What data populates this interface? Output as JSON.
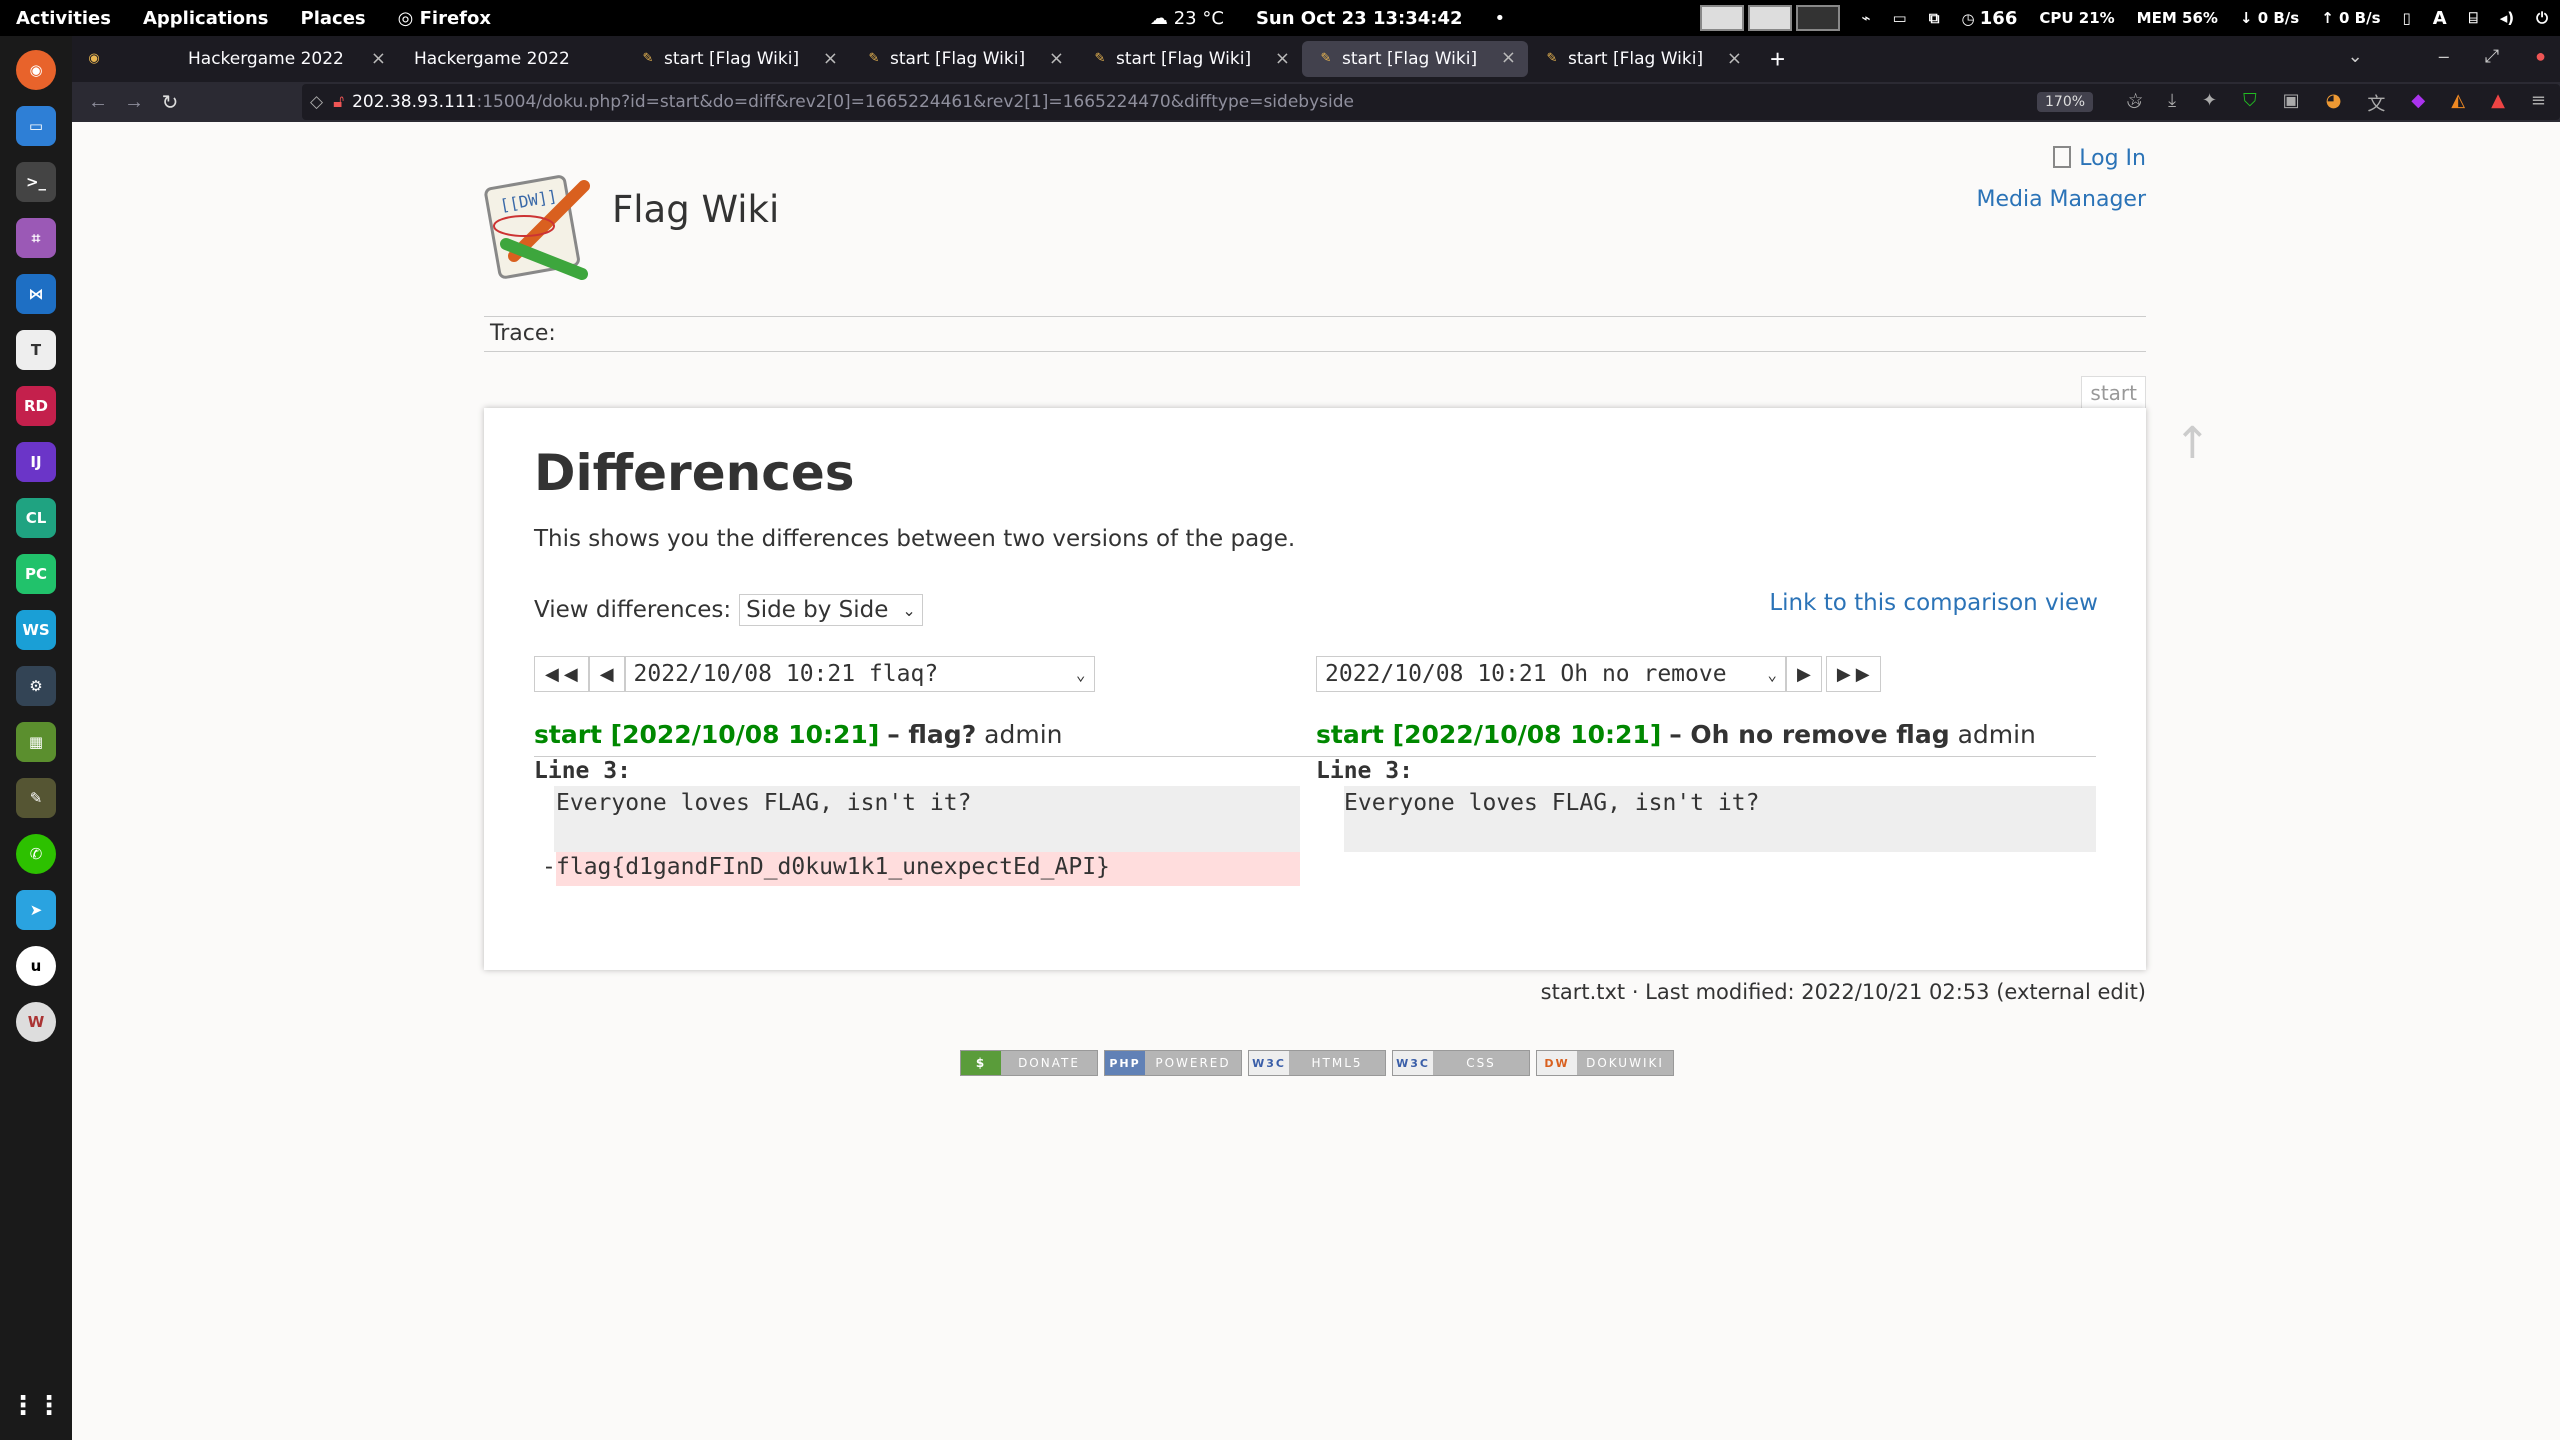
{
  "topbar": {
    "activities": "Activities",
    "applications": "Applications",
    "places": "Places",
    "firefox": "Firefox",
    "weather": "23 °C",
    "datetime": "Sun Oct 23  13:34:42",
    "dot": "•",
    "process_count": "166",
    "cpu_label": "CPU",
    "cpu_value": "21%",
    "mem_label": "MEM",
    "mem_value": "56%",
    "down_rate": "0 B/s",
    "up_rate": "0 B/s",
    "keyboard": "A"
  },
  "tabs": [
    {
      "label": "Hackergame 2022",
      "favicon": "dot-icon"
    },
    {
      "label": "Hackergame 2022",
      "favicon": "dot-icon"
    },
    {
      "label": "start [Flag Wiki]",
      "favicon": "dokuwiki-icon"
    },
    {
      "label": "start [Flag Wiki]",
      "favicon": "dokuwiki-icon"
    },
    {
      "label": "start [Flag Wiki]",
      "favicon": "dokuwiki-icon"
    },
    {
      "label": "start [Flag Wiki]",
      "favicon": "dokuwiki-icon",
      "active": true
    },
    {
      "label": "start [Flag Wiki]",
      "favicon": "dokuwiki-icon"
    }
  ],
  "navbar": {
    "url_host": "202.38.93.111",
    "url_rest": ":15004/doku.php?id=start&do=diff&rev2[0]=1665224461&rev2[1]=1665224470&difftype=sidebyside",
    "zoom": "170%"
  },
  "site": {
    "title": "Flag Wiki",
    "login": "Log In",
    "media_manager": "Media Manager",
    "trace": "Trace:",
    "page_tab": "start"
  },
  "diff": {
    "heading": "Differences",
    "intro": "This shows you the differences between two versions of the page.",
    "view_label": "View differences:",
    "view_value": "Side by Side",
    "compare_link": "Link to this comparison view",
    "left_select": "2022/10/08 10:21 flaq?",
    "right_select": "2022/10/08 10:21 Oh no remove",
    "left": {
      "link": "start [2022/10/08 10:21]",
      "summary": "– flag?",
      "user": "admin",
      "line_label": "Line 3:",
      "context": "Everyone loves FLAG, isn't it?",
      "deleted_sign": "-",
      "deleted": "flag{d1gandFInD_d0kuw1k1_unexpectEd_API}"
    },
    "right": {
      "link": "start [2022/10/08 10:21]",
      "summary": "– Oh no remove flag",
      "user": "admin",
      "line_label": "Line 3:",
      "context": "Everyone loves FLAG, isn't it?"
    }
  },
  "footer": {
    "last_modified": "start.txt · Last modified: 2022/10/21 02:53 (external edit)",
    "badges": [
      {
        "icon": "$",
        "label": "DONATE",
        "color": "#5a9c3a"
      },
      {
        "icon": "PHP",
        "label": "POWERED",
        "color": "#6181b6"
      },
      {
        "icon": "W3C",
        "label": "HTML5",
        "color": "#bbbbbb"
      },
      {
        "icon": "W3C",
        "label": "CSS",
        "color": "#bbbbbb"
      },
      {
        "icon": "DW",
        "label": "DOKUWIKI",
        "color": "#bbbbbb"
      }
    ]
  }
}
